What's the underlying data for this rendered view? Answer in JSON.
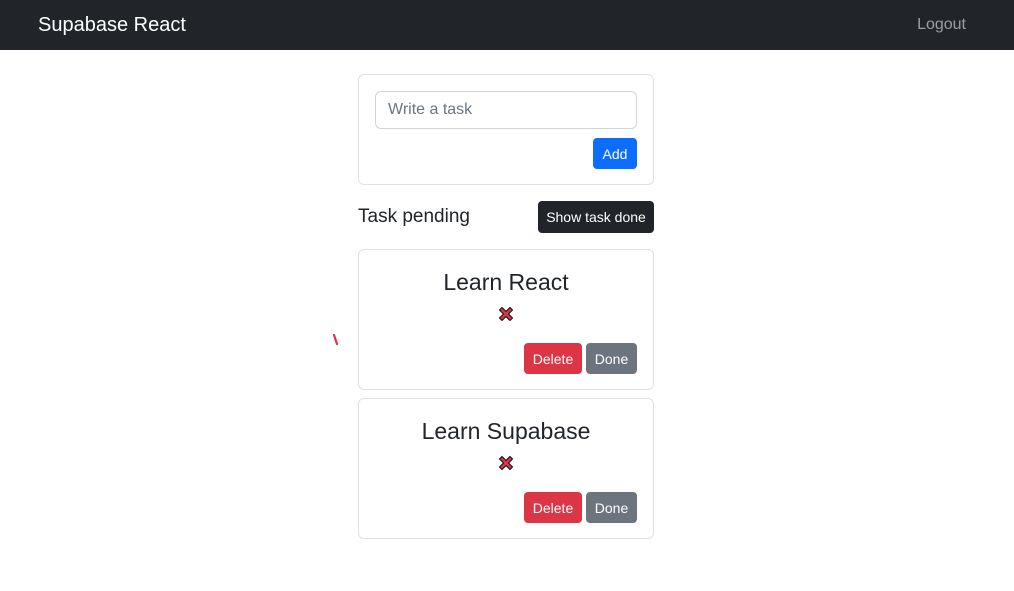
{
  "navbar": {
    "brand": "Supabase React",
    "logout_label": "Logout"
  },
  "task_form": {
    "placeholder": "Write a task",
    "value": "",
    "add_label": "Add"
  },
  "pending_section": {
    "title": "Task pending",
    "toggle_label": "Show task done"
  },
  "tasks": [
    {
      "title": "Learn React",
      "status_icon": "cross-mark-icon",
      "delete_label": "Delete",
      "done_label": "Done"
    },
    {
      "title": "Learn Supabase",
      "status_icon": "cross-mark-icon",
      "delete_label": "Delete",
      "done_label": "Done"
    }
  ],
  "colors": {
    "navbar_bg": "#212529",
    "primary": "#0d6efd",
    "danger": "#dc3545",
    "secondary": "#6c757d",
    "status_cross": "#dc3545"
  }
}
